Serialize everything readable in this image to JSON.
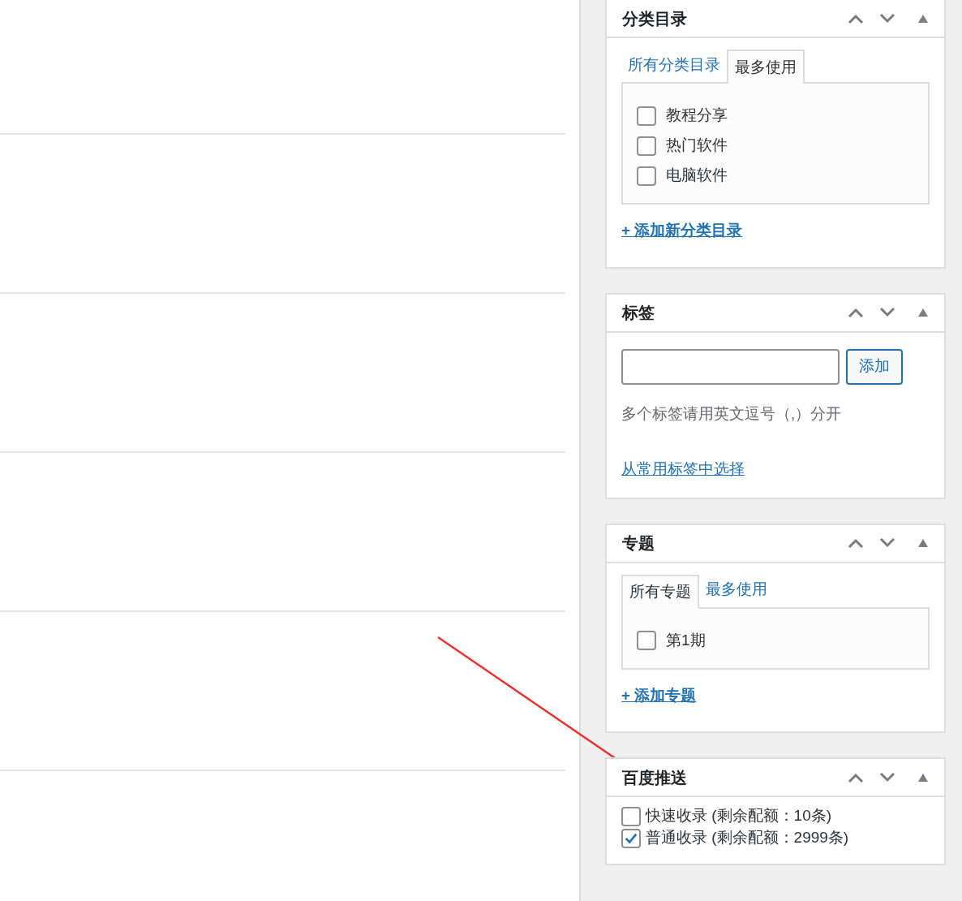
{
  "panels": [
    {
      "kind": "category",
      "title": "分类目录",
      "tabs": [
        {
          "label": "所有分类目录",
          "selected": false
        },
        {
          "label": "最多使用",
          "selected": true
        }
      ],
      "items": [
        {
          "label": "教程分享",
          "checked": false
        },
        {
          "label": "热门软件",
          "checked": false
        },
        {
          "label": "电脑软件",
          "checked": false
        }
      ],
      "add_link": "+ 添加新分类目录"
    },
    {
      "kind": "tags",
      "title": "标签",
      "button": "添加",
      "hint": "多个标签请用英文逗号（,）分开",
      "link": "从常用标签中选择"
    },
    {
      "kind": "category",
      "title": "专题",
      "tabs": [
        {
          "label": "所有专题",
          "selected": true
        },
        {
          "label": "最多使用",
          "selected": false
        }
      ],
      "items": [
        {
          "label": "第1期",
          "checked": false
        }
      ],
      "add_link": "+ 添加专题"
    },
    {
      "kind": "push",
      "title": "百度推送",
      "items": [
        {
          "label": "快速收录 (剩余配额：10条)",
          "checked": false
        },
        {
          "label": "普通收录 (剩余配额：2999条)",
          "checked": true
        }
      ]
    }
  ]
}
